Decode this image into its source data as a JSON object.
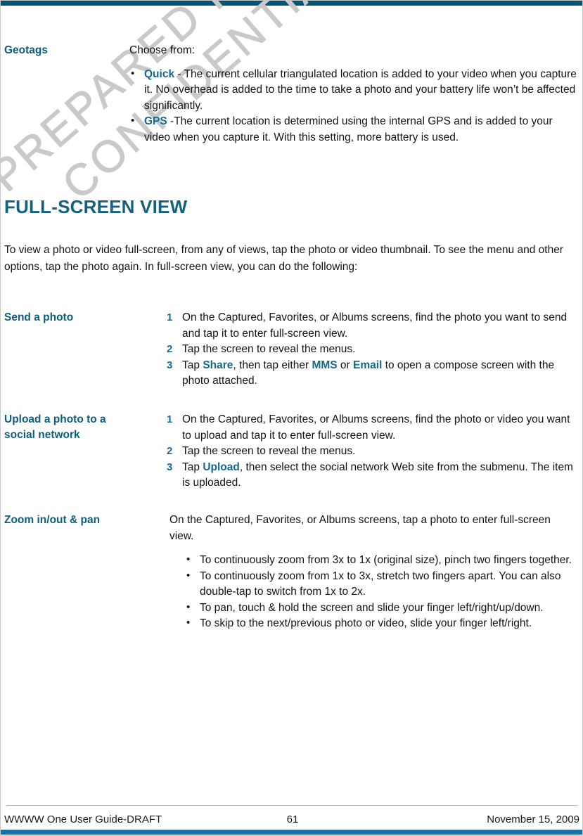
{
  "document": {
    "accent_color": "#13607f",
    "rule_color_top": "#005577",
    "rule_color_bottom": "#1d6fa5",
    "watermark": {
      "line1": "PREPARED FOR FCC CERTIFICATION",
      "line2": "CONFIDENTIAL"
    }
  },
  "geotags": {
    "term": "Geotags",
    "lead": "Choose from:",
    "bullets": [
      {
        "keyword": "Quick",
        "text": " - The current cellular triangulated location is added to your video when you capture it. No overhead is added to the time to take a photo and your battery life won’t be affected significantly."
      },
      {
        "keyword": "GPS",
        "text": " -The current location is determined using the internal GPS and is added to your video when you capture it. With this setting, more battery is used."
      }
    ]
  },
  "section": {
    "heading": "FULL-SCREEN VIEW",
    "intro": "To view a photo or video full-screen, from any of views, tap the photo or video thumbnail. To see the menu and other options, tap the photo again. In full-screen view, you can do the following:"
  },
  "send_photo": {
    "term": "Send a photo",
    "steps": [
      {
        "num": "1",
        "text": "On the Captured, Favorites, or Albums screens, find the photo you want to send and tap it to enter full-screen view."
      },
      {
        "num": "2",
        "text": "Tap the screen to reveal the menus."
      },
      {
        "num": "3",
        "pre": "Tap ",
        "kw1": "Share",
        "mid1": ", then tap either ",
        "kw2": "MMS",
        "mid2": " or ",
        "kw3": "Email",
        "post": " to open a compose screen with the photo attached."
      }
    ]
  },
  "upload_photo": {
    "term_line1": "Upload a photo to a",
    "term_line2": "social network",
    "steps": [
      {
        "num": "1",
        "text": "On the Captured, Favorites, or Albums screens, find the photo or video you want to upload and tap it to enter full-screen view."
      },
      {
        "num": "2",
        "text": "Tap the screen to reveal the menus."
      },
      {
        "num": "3",
        "pre": "Tap ",
        "kw1": "Upload",
        "post": ", then select the social network Web site from the submenu. The item is uploaded."
      }
    ]
  },
  "zoom_pan": {
    "term": "Zoom in/out & pan",
    "lead": "On the Captured, Favorites, or Albums screens, tap a photo to enter full-screen view.",
    "bullets": [
      "To continuously zoom from 3x to 1x (original size),  pinch two fingers together.",
      "To continuously zoom from 1x to 3x, stretch two fingers apart. You can also double-tap to switch from 1x to 2x.",
      "To pan, touch & hold the screen and slide your finger left/right/up/down.",
      "To skip to the next/previous photo or video, slide your finger left/right."
    ]
  },
  "footer": {
    "left": "WWWW One User Guide-DRAFT",
    "page_number": "61",
    "right": "November 15, 2009"
  }
}
